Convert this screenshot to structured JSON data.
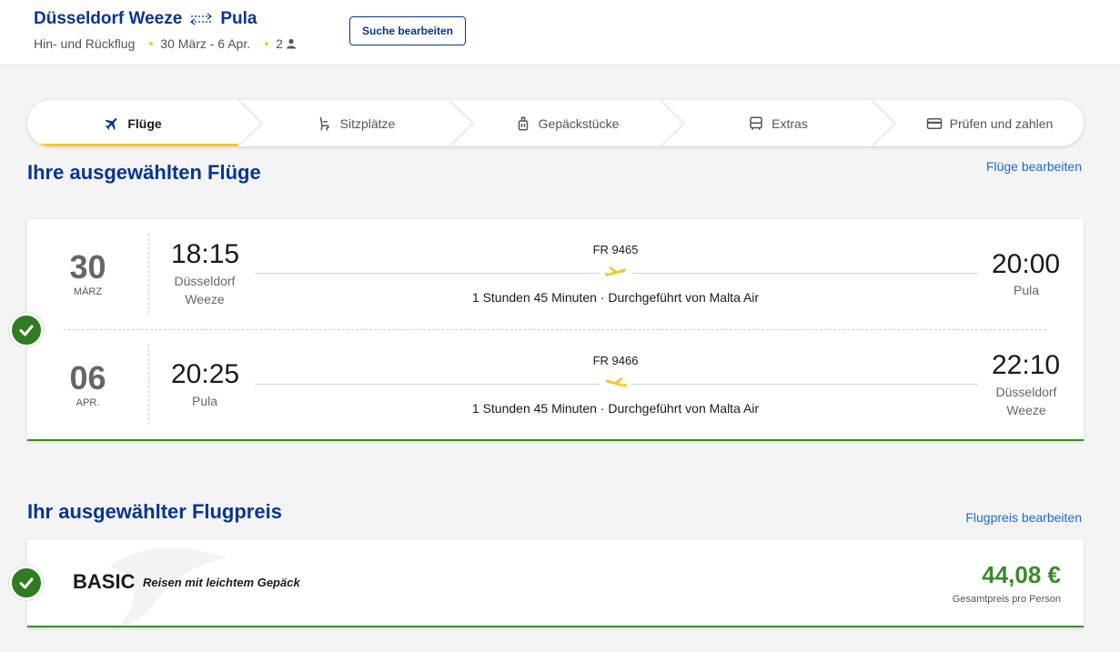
{
  "header": {
    "origin": "Düsseldorf Weeze",
    "destination": "Pula",
    "trip_type": "Hin- und Rückflug",
    "dates": "30 März - 6 Apr.",
    "passengers": "2",
    "edit_search_label": "Suche bearbeiten"
  },
  "steps": [
    {
      "label": "Flüge",
      "icon": "plane-icon",
      "active": true
    },
    {
      "label": "Sitzplätze",
      "icon": "seat-icon",
      "active": false
    },
    {
      "label": "Gepäckstücke",
      "icon": "luggage-icon",
      "active": false
    },
    {
      "label": "Extras",
      "icon": "bus-icon",
      "active": false
    },
    {
      "label": "Prüfen und zahlen",
      "icon": "card-icon",
      "active": false
    }
  ],
  "flights_section": {
    "title": "Ihre ausgewählten Flüge",
    "edit_label": "Flüge bearbeiten"
  },
  "flights": [
    {
      "day": "30",
      "month": "MÄRZ",
      "dep_time": "18:15",
      "dep_city": "Düsseldorf Weeze",
      "flight_number": "FR 9465",
      "duration": "1 Stunden 45 Minuten · Durchgeführt von Malta Air",
      "arr_time": "20:00",
      "arr_city": "Pula"
    },
    {
      "day": "06",
      "month": "APR.",
      "dep_time": "20:25",
      "dep_city": "Pula",
      "flight_number": "FR 9466",
      "duration": "1 Stunden 45 Minuten · Durchgeführt von Malta Air",
      "arr_time": "22:10",
      "arr_city": "Düsseldorf Weeze"
    }
  ],
  "fare_section": {
    "title": "Ihr ausgewählter Flugpreis",
    "edit_label": "Flugpreis bearbeiten",
    "fare_name": "BASIC",
    "fare_description": "Reisen mit leichtem Gepäck",
    "price": "44,08 €",
    "price_note": "Gesamtpreis pro Person"
  },
  "colors": {
    "brand_blue": "#073590",
    "accent_yellow": "#f1c933",
    "success_green": "#2f7d22",
    "price_green": "#3b8a2a",
    "link_blue": "#1a6ad1"
  }
}
